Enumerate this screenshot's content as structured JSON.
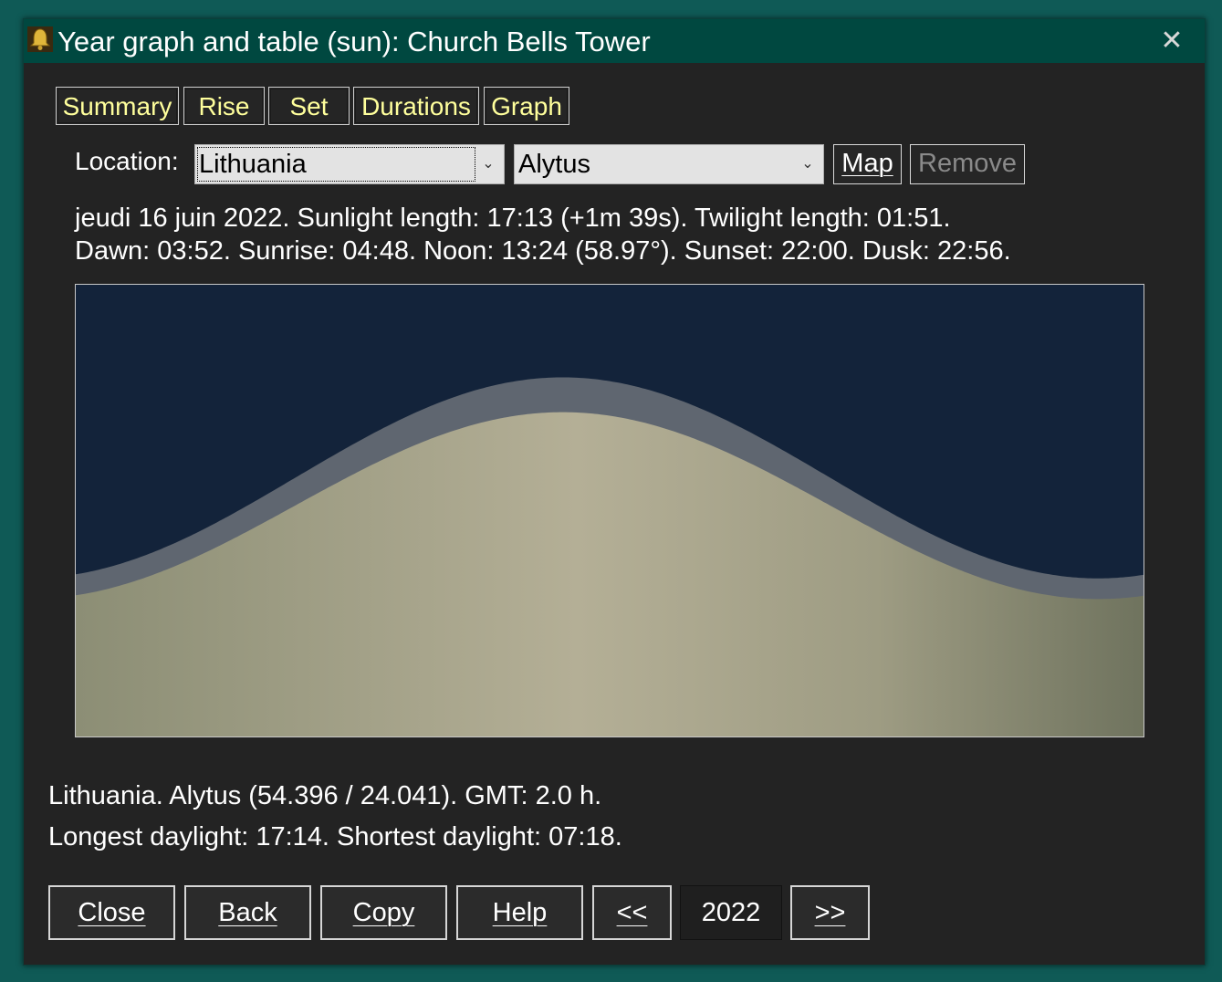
{
  "window": {
    "title": "Year graph and table (sun): Church Bells Tower",
    "close_glyph": "✕"
  },
  "tabs": [
    {
      "label": "Summary"
    },
    {
      "label": "Rise"
    },
    {
      "label": "Set"
    },
    {
      "label": "Durations"
    },
    {
      "label": "Graph"
    }
  ],
  "location": {
    "label": "Location:",
    "country": "Lithuania",
    "city": "Alytus",
    "map_button": "Map",
    "remove_button": "Remove"
  },
  "day_info": {
    "line1": "jeudi 16 juin 2022. Sunlight length: 17:13 (+1m 39s). Twilight length: 01:51.",
    "line2": "Dawn: 03:52. Sunrise: 04:48. Noon: 13:24 (58.97°). Sunset: 22:00. Dusk: 22:56."
  },
  "footer": {
    "line1": "Lithuania. Alytus (54.396 / 24.041). GMT: 2.0 h.",
    "line2": "Longest daylight: 17:14. Shortest daylight: 07:18."
  },
  "buttons": {
    "close": "Close",
    "back": "Back",
    "copy": "Copy",
    "help": "Help",
    "prev": "<<",
    "year": "2022",
    "next": ">>"
  },
  "colors": {
    "title_bar": "#004840",
    "tab_text": "#ffff9c",
    "night": "#13233a",
    "twilight": "#5f6670",
    "daylight": "#b2ad93"
  },
  "chart_data": {
    "type": "area",
    "title": "",
    "xlabel": "",
    "ylabel": "",
    "x_range": [
      1,
      365
    ],
    "longest_daylight_hours": 17.23,
    "shortest_daylight_hours": 7.3,
    "longest_day_index": 167,
    "daylight_plus_twilight_hours_max": 19.08,
    "daylight_plus_twilight_hours_min": 8.4
  }
}
